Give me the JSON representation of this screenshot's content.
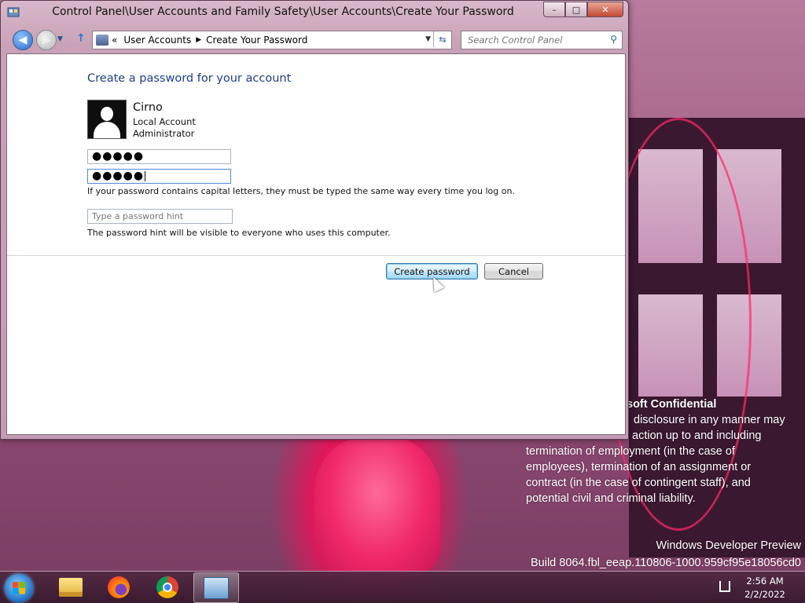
{
  "window": {
    "title": "Control Panel\\User Accounts and Family Safety\\User Accounts\\Create Your Password",
    "min_glyph": "–",
    "max_glyph": "□",
    "close_glyph": "✕"
  },
  "nav": {
    "breadcrumb": [
      "User Accounts",
      "Create Your Password"
    ],
    "breadcrumb_prefix": "«",
    "search_placeholder": "Search Control Panel"
  },
  "page": {
    "heading": "Create a password for your account",
    "user": {
      "name": "Cirno",
      "account_type": "Local Account",
      "role": "Administrator"
    },
    "password_masked": "●●●●●",
    "confirm_masked": "●●●●●",
    "capital_letters_note": "If your password contains capital letters, they must be typed the same way every time you log on.",
    "hint_placeholder": "Type a password hint",
    "hint_note": "The password hint will be visible to everyone who uses this computer.",
    "create_button": "Create password",
    "cancel_button": "Cancel"
  },
  "watermark": {
    "line1": "soft Confidential",
    "line2": "disclosure in any manner may",
    "line3": "action up to and including",
    "line4": "termination of employment (in the case of",
    "line5": "employees), termination of an assignment or",
    "line6": "contract (in the case of contingent staff), and",
    "line7": "potential civil and criminal liability.",
    "build_line1": "Windows Developer Preview",
    "build_line2": "Build 8064.fbl_eeap.110806-1000.959cf95e18056cd0"
  },
  "taskbar": {
    "items": [
      "windows-explorer",
      "firefox",
      "chrome",
      "control-panel"
    ],
    "clock_time": "2:56 AM",
    "clock_date": "2/2/2022"
  },
  "colors": {
    "heading_blue": "#1e3f8a",
    "window_frame": "#c9a2b8"
  }
}
